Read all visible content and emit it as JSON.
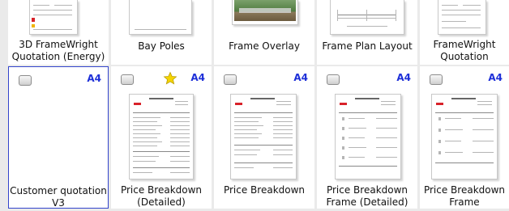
{
  "tiles_top": [
    {
      "caption": "3D FrameWright Quotation (Energy)"
    },
    {
      "caption": "Bay Poles"
    },
    {
      "caption": "Frame Overlay"
    },
    {
      "caption": "Frame Plan Layout"
    },
    {
      "caption": "FrameWright Quotation"
    }
  ],
  "tiles_bottom": [
    {
      "caption": "Customer quotation V3",
      "paper": "A4",
      "selected": true,
      "favorite": false
    },
    {
      "caption": "Price Breakdown (Detailed)",
      "paper": "A4",
      "selected": false,
      "favorite": true
    },
    {
      "caption": "Price Breakdown",
      "paper": "A4",
      "selected": false,
      "favorite": false
    },
    {
      "caption": "Price Breakdown Frame (Detailed)",
      "paper": "A4",
      "selected": false,
      "favorite": false
    },
    {
      "caption": "Price Breakdown Frame",
      "paper": "A4",
      "selected": false,
      "favorite": false
    }
  ],
  "icons": {
    "checkbox": "checkbox-icon",
    "favorite": "star-icon"
  },
  "colors": {
    "selection": "#3344cc",
    "paper_label": "#1d2fd8",
    "star": "#f5d400"
  }
}
